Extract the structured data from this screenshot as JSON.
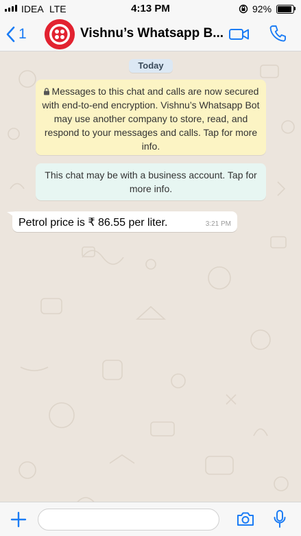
{
  "status_bar": {
    "carrier": "IDEA",
    "network": "LTE",
    "time": "4:13 PM",
    "battery_percent": "92%",
    "battery_level": 0.92
  },
  "header": {
    "back_count": "1",
    "contact_name": "Vishnu’s Whatsapp B...",
    "icons": [
      "back-chevron-icon",
      "twilio-logo-avatar",
      "video-call-icon",
      "phone-call-icon"
    ],
    "accent_color": "#1b7cf5",
    "avatar_color": "#e22230"
  },
  "chat": {
    "day_label": "Today",
    "encryption_notice": "Messages to this chat and calls are now secured with end-to-end encryption. Vishnu’s Whatsapp Bot may use another company to store, read, and respond to your messages and calls. Tap for more info.",
    "business_notice": "This chat may be with a business account. Tap for more info.",
    "messages": [
      {
        "text": "Petrol price is ₹ 86.55 per liter.",
        "time": "3:21 PM",
        "direction": "incoming"
      }
    ],
    "notice_colors": {
      "encryption": "#fcf4c4",
      "business": "#e7f6f2",
      "day_chip": "#dce8f4"
    }
  },
  "input_bar": {
    "placeholder": "",
    "icons": [
      "plus-icon",
      "camera-icon",
      "microphone-icon"
    ]
  }
}
